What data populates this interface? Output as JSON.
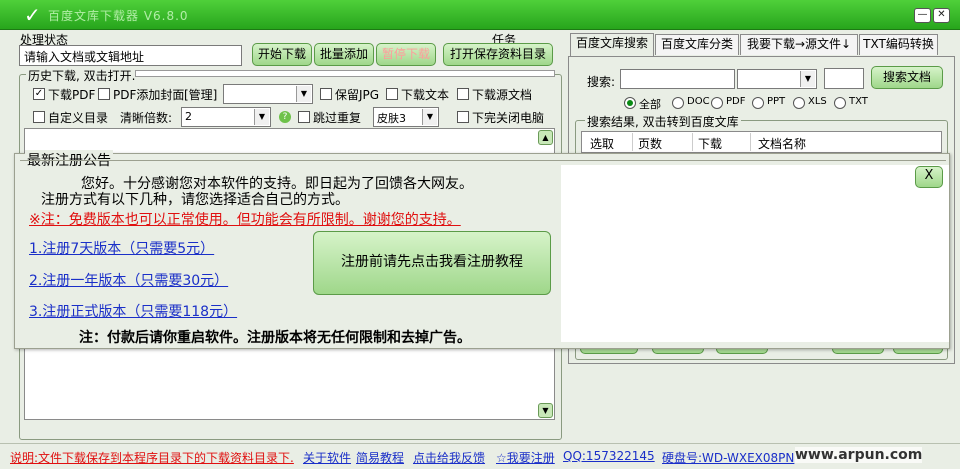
{
  "window": {
    "title": "百度文库下载器 V6.8.0",
    "minimize_label": "—",
    "close_label": "✕"
  },
  "left": {
    "status_label": "处理状态",
    "task_label": "任务",
    "url_input_placeholder": "请输入文档或文辑地址",
    "buttons": {
      "start": "开始下载",
      "batch": "批量添加",
      "pause": "暂停下载",
      "open": "打开保存资料目录"
    },
    "history_group_title": "历史下载, 双击打开.",
    "options": {
      "download_pdf": "下载PDF",
      "pdf_cover": "PDF添加封面",
      "manage": "[管理]",
      "keep_jpg": "保留JPG",
      "download_text": "下载文本",
      "download_source": "下载源文档",
      "custom_dir": "自定义目录",
      "clarity_label": "清晰倍数:",
      "clarity_value": "2",
      "skip_duplicate": "跳过重复",
      "skin_value": "皮肤3",
      "shutdown": "下完关闭电脑"
    }
  },
  "right": {
    "tabs": [
      "百度文库搜索",
      "百度文库分类",
      "我要下载→源文件↓",
      "TXT编码转换"
    ],
    "search_label": "搜索:",
    "search_button": "搜索文档",
    "filters": [
      "全部",
      "DOC",
      "PDF",
      "PPT",
      "XLS",
      "TXT"
    ],
    "results_group_title": "搜索结果, 双击转到百度文库",
    "columns": [
      "选取",
      "页数",
      "下载",
      "文档名称"
    ]
  },
  "notice": {
    "title": "最新注册公告",
    "line1": "您好。十分感谢您对本软件的支持。即日起为了回馈各大网友。",
    "line2": "注册方式有以下几种，请您选择适合自己的方式。",
    "warning": "※注：免费版本也可以正常使用。但功能会有所限制。谢谢您的支持。",
    "options": [
      "1.注册7天版本（只需要5元）",
      "2.注册一年版本（只需要30元）",
      "3.注册正式版本（只需要118元）"
    ],
    "tutorial_button": "注册前请先点击我看注册教程",
    "footer": "注：付款后请你重启软件。注册版本将无任何限制和去掉广告。",
    "close_label": "X"
  },
  "statusbar": {
    "note": "说明:文件下载保存到本程序目录下的下载资料目录下.",
    "links": [
      "关于软件",
      "简易教程",
      "点击给我反馈",
      "☆我要注册"
    ],
    "qq": "QQ:157322145",
    "disk": "硬盘号:WD-WXEX08PN",
    "watermark": "www.arpun.com"
  },
  "colors": {
    "title_green": "#27a51c",
    "warning_red": "#e01010",
    "link_blue": "#1a2fc8"
  }
}
